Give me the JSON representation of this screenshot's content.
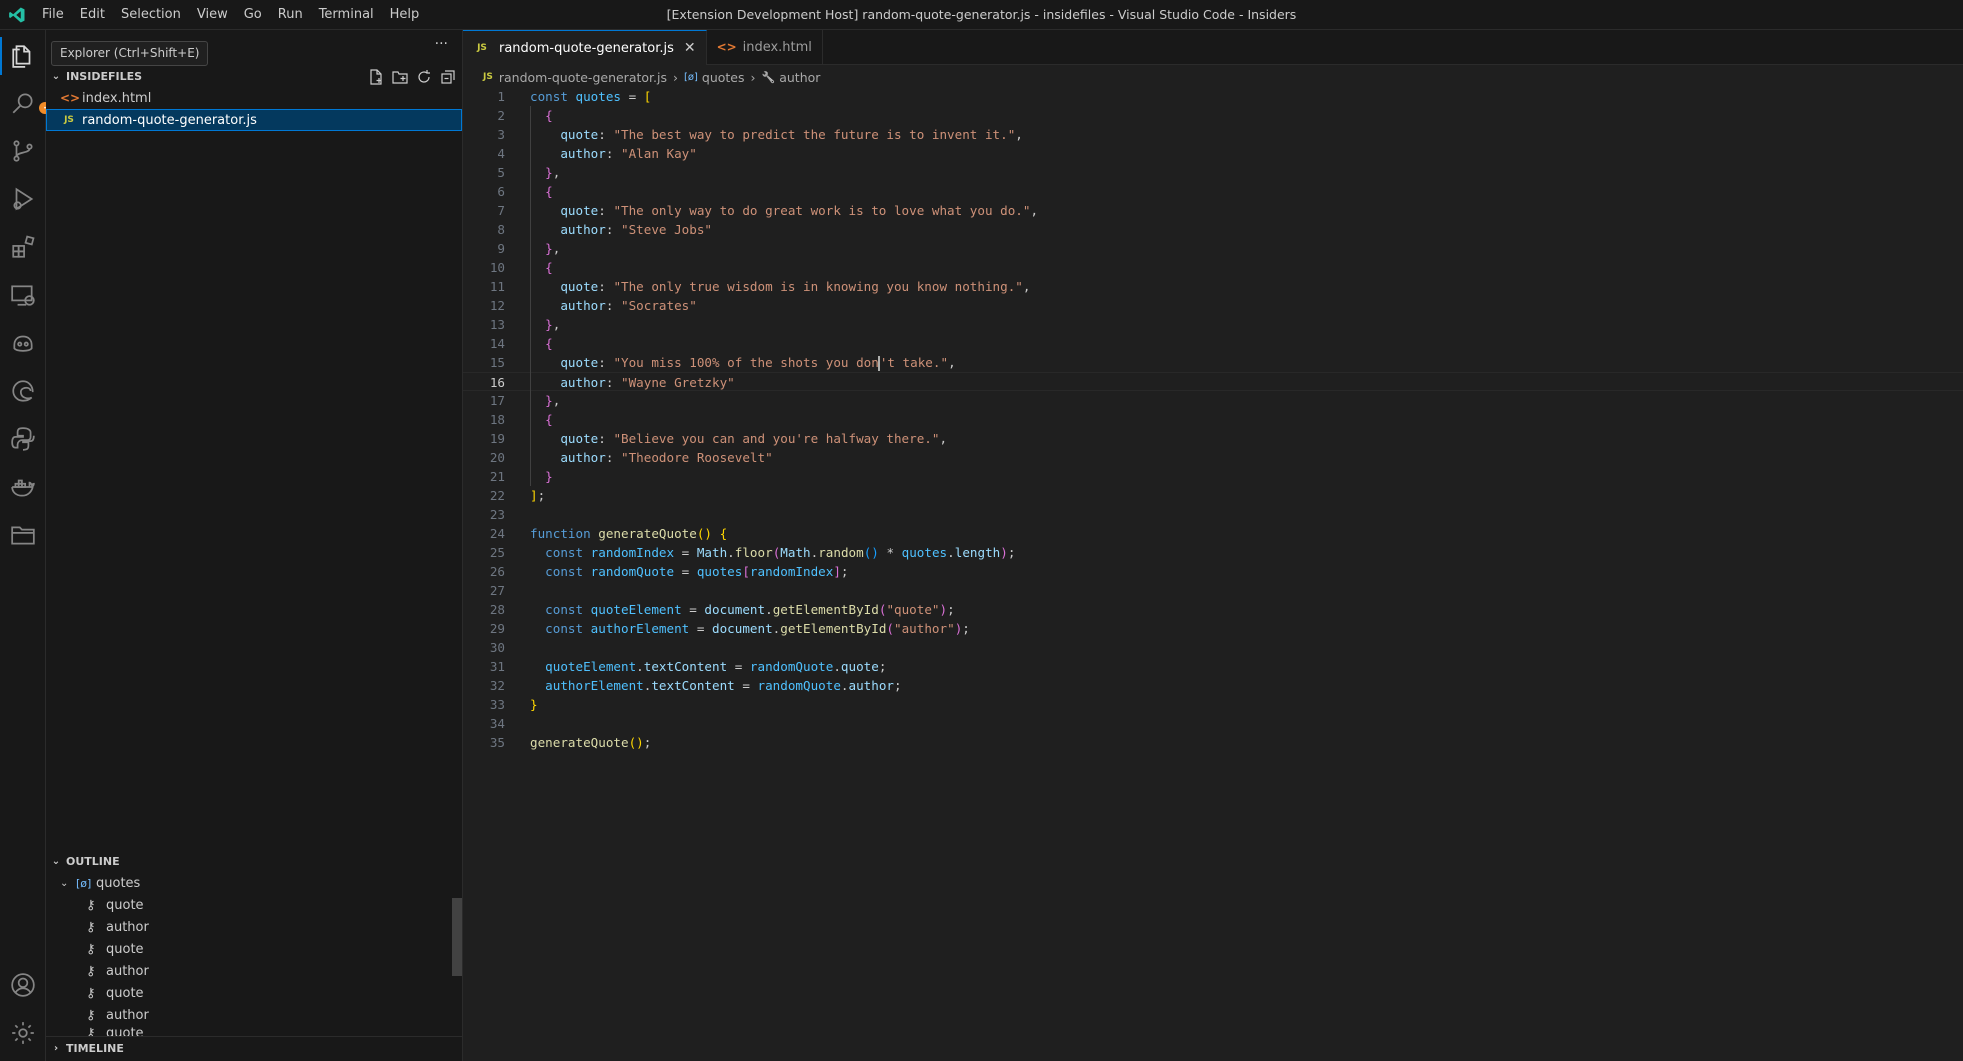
{
  "titlebar": {
    "menu": [
      "File",
      "Edit",
      "Selection",
      "View",
      "Go",
      "Run",
      "Terminal",
      "Help"
    ],
    "window_title": "[Extension Development Host] random-quote-generator.js - insidefiles - Visual Studio Code - Insiders"
  },
  "tooltip": {
    "text": "Explorer (Ctrl+Shift+E)"
  },
  "activitybar": {
    "icons": [
      "files-icon",
      "search-icon",
      "source-control-icon",
      "run-debug-icon",
      "extensions-icon",
      "remote-explorer-icon",
      "copilot-icon",
      "edge-icon",
      "python-icon",
      "docker-icon",
      "folder-icon",
      "account-icon",
      "settings-gear-icon"
    ]
  },
  "explorer": {
    "section_title": "INSIDEFILES",
    "more_actions": "···",
    "files": [
      {
        "name": "index.html",
        "icon": "<>",
        "type": "html"
      },
      {
        "name": "random-quote-generator.js",
        "icon": "JS",
        "type": "js",
        "selected": true
      }
    ]
  },
  "outline": {
    "section_title": "OUTLINE",
    "root": {
      "icon": "[ø]",
      "label": "quotes"
    },
    "items": [
      "quote",
      "author",
      "quote",
      "author",
      "quote",
      "author",
      "quote"
    ]
  },
  "timeline": {
    "section_title": "TIMELINE"
  },
  "tabs": [
    {
      "label": "random-quote-generator.js",
      "icon": "JS",
      "active": true,
      "close": "✕"
    },
    {
      "label": "index.html",
      "icon": "<>",
      "active": false
    }
  ],
  "breadcrumb": {
    "file_icon": "JS",
    "file": "random-quote-generator.js",
    "symbol_icon": "[ø]",
    "symbol": "quotes",
    "field_icon": "🔧",
    "field": "author"
  },
  "editor": {
    "current_line": 16,
    "lines": [
      [
        [
          "k",
          "const "
        ],
        [
          "v",
          "quotes"
        ],
        [
          "o",
          " = "
        ],
        [
          "b1",
          "["
        ]
      ],
      [
        [
          "o",
          "  "
        ],
        [
          "b2",
          "{"
        ]
      ],
      [
        [
          "o",
          "    "
        ],
        [
          "p",
          "quote"
        ],
        [
          "o",
          ": "
        ],
        [
          "s",
          "\"The best way to predict the future is to invent it.\""
        ],
        [
          "o",
          ","
        ]
      ],
      [
        [
          "o",
          "    "
        ],
        [
          "p",
          "author"
        ],
        [
          "o",
          ": "
        ],
        [
          "s",
          "\"Alan Kay\""
        ]
      ],
      [
        [
          "o",
          "  "
        ],
        [
          "b2",
          "}"
        ],
        [
          "o",
          ","
        ]
      ],
      [
        [
          "o",
          "  "
        ],
        [
          "b2",
          "{"
        ]
      ],
      [
        [
          "o",
          "    "
        ],
        [
          "p",
          "quote"
        ],
        [
          "o",
          ": "
        ],
        [
          "s",
          "\"The only way to do great work is to love what you do.\""
        ],
        [
          "o",
          ","
        ]
      ],
      [
        [
          "o",
          "    "
        ],
        [
          "p",
          "author"
        ],
        [
          "o",
          ": "
        ],
        [
          "s",
          "\"Steve Jobs\""
        ]
      ],
      [
        [
          "o",
          "  "
        ],
        [
          "b2",
          "}"
        ],
        [
          "o",
          ","
        ]
      ],
      [
        [
          "o",
          "  "
        ],
        [
          "b2",
          "{"
        ]
      ],
      [
        [
          "o",
          "    "
        ],
        [
          "p",
          "quote"
        ],
        [
          "o",
          ": "
        ],
        [
          "s",
          "\"The only true wisdom is in knowing you know nothing.\""
        ],
        [
          "o",
          ","
        ]
      ],
      [
        [
          "o",
          "    "
        ],
        [
          "p",
          "author"
        ],
        [
          "o",
          ": "
        ],
        [
          "s",
          "\"Socrates\""
        ]
      ],
      [
        [
          "o",
          "  "
        ],
        [
          "b2",
          "}"
        ],
        [
          "o",
          ","
        ]
      ],
      [
        [
          "o",
          "  "
        ],
        [
          "b2",
          "{"
        ]
      ],
      [
        [
          "o",
          "    "
        ],
        [
          "p",
          "quote"
        ],
        [
          "o",
          ": "
        ],
        [
          "s",
          "\"You miss 100% of the shots you don"
        ],
        [
          "cursor",
          ""
        ],
        [
          "s",
          "'t take.\""
        ],
        [
          "o",
          ","
        ]
      ],
      [
        [
          "o",
          "    "
        ],
        [
          "p",
          "author"
        ],
        [
          "o",
          ": "
        ],
        [
          "s",
          "\"Wayne Gretzky\""
        ]
      ],
      [
        [
          "o",
          "  "
        ],
        [
          "b2",
          "}"
        ],
        [
          "o",
          ","
        ]
      ],
      [
        [
          "o",
          "  "
        ],
        [
          "b2",
          "{"
        ]
      ],
      [
        [
          "o",
          "    "
        ],
        [
          "p",
          "quote"
        ],
        [
          "o",
          ": "
        ],
        [
          "s",
          "\"Believe you can and you're halfway there.\""
        ],
        [
          "o",
          ","
        ]
      ],
      [
        [
          "o",
          "    "
        ],
        [
          "p",
          "author"
        ],
        [
          "o",
          ": "
        ],
        [
          "s",
          "\"Theodore Roosevelt\""
        ]
      ],
      [
        [
          "o",
          "  "
        ],
        [
          "b2",
          "}"
        ]
      ],
      [
        [
          "b1",
          "]"
        ],
        [
          "o",
          ";"
        ]
      ],
      [],
      [
        [
          "k",
          "function "
        ],
        [
          "f",
          "generateQuote"
        ],
        [
          "b1",
          "()"
        ],
        [
          "o",
          " "
        ],
        [
          "b1",
          "{"
        ]
      ],
      [
        [
          "o",
          "  "
        ],
        [
          "k",
          "const "
        ],
        [
          "v",
          "randomIndex"
        ],
        [
          "o",
          " = "
        ],
        [
          "p",
          "Math"
        ],
        [
          "o",
          "."
        ],
        [
          "f",
          "floor"
        ],
        [
          "b2",
          "("
        ],
        [
          "p",
          "Math"
        ],
        [
          "o",
          "."
        ],
        [
          "f",
          "random"
        ],
        [
          "b3",
          "()"
        ],
        [
          "o",
          " * "
        ],
        [
          "v",
          "quotes"
        ],
        [
          "o",
          "."
        ],
        [
          "p",
          "length"
        ],
        [
          "b2",
          ")"
        ],
        [
          "o",
          ";"
        ]
      ],
      [
        [
          "o",
          "  "
        ],
        [
          "k",
          "const "
        ],
        [
          "v",
          "randomQuote"
        ],
        [
          "o",
          " = "
        ],
        [
          "v",
          "quotes"
        ],
        [
          "b2",
          "["
        ],
        [
          "v",
          "randomIndex"
        ],
        [
          "b2",
          "]"
        ],
        [
          "o",
          ";"
        ]
      ],
      [],
      [
        [
          "o",
          "  "
        ],
        [
          "k",
          "const "
        ],
        [
          "v",
          "quoteElement"
        ],
        [
          "o",
          " = "
        ],
        [
          "p",
          "document"
        ],
        [
          "o",
          "."
        ],
        [
          "f",
          "getElementById"
        ],
        [
          "b2",
          "("
        ],
        [
          "s",
          "\"quote\""
        ],
        [
          "b2",
          ")"
        ],
        [
          "o",
          ";"
        ]
      ],
      [
        [
          "o",
          "  "
        ],
        [
          "k",
          "const "
        ],
        [
          "v",
          "authorElement"
        ],
        [
          "o",
          " = "
        ],
        [
          "p",
          "document"
        ],
        [
          "o",
          "."
        ],
        [
          "f",
          "getElementById"
        ],
        [
          "b2",
          "("
        ],
        [
          "s",
          "\"author\""
        ],
        [
          "b2",
          ")"
        ],
        [
          "o",
          ";"
        ]
      ],
      [],
      [
        [
          "o",
          "  "
        ],
        [
          "v",
          "quoteElement"
        ],
        [
          "o",
          "."
        ],
        [
          "p",
          "textContent"
        ],
        [
          "o",
          " = "
        ],
        [
          "v",
          "randomQuote"
        ],
        [
          "o",
          "."
        ],
        [
          "p",
          "quote"
        ],
        [
          "o",
          ";"
        ]
      ],
      [
        [
          "o",
          "  "
        ],
        [
          "v",
          "authorElement"
        ],
        [
          "o",
          "."
        ],
        [
          "p",
          "textContent"
        ],
        [
          "o",
          " = "
        ],
        [
          "v",
          "randomQuote"
        ],
        [
          "o",
          "."
        ],
        [
          "p",
          "author"
        ],
        [
          "o",
          ";"
        ]
      ],
      [
        [
          "b1",
          "}"
        ]
      ],
      [],
      [
        [
          "f",
          "generateQuote"
        ],
        [
          "b1",
          "()"
        ],
        [
          "o",
          ";"
        ]
      ]
    ]
  }
}
